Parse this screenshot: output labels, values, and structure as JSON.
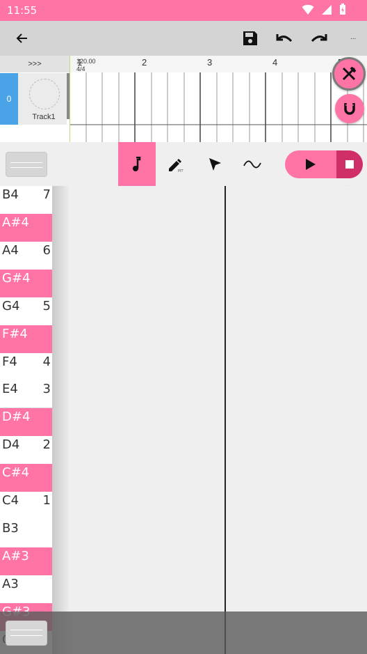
{
  "status": {
    "time": "11:55"
  },
  "toolbar": {
    "more_label": "..."
  },
  "tracks": {
    "header": ">>>",
    "ruler": {
      "bars": [
        "1",
        "2",
        "3",
        "4",
        "5"
      ],
      "tempo": "120.00",
      "time_signature": "4/4"
    },
    "items": [
      {
        "number": "0",
        "name": "Track1",
        "color": "#4aa3e6"
      }
    ]
  },
  "tools": [
    "note-tool",
    "pencil-tool",
    "select-tool",
    "curve-tool"
  ],
  "active_tool": "note-tool",
  "colors": {
    "accent": "#ff73a6",
    "accent_dark": "#cf2e68",
    "toolbar": "#d4d4d4"
  },
  "keys": [
    {
      "name": "B4",
      "octave": "7",
      "sharp": false
    },
    {
      "name": "A#4",
      "octave": "",
      "sharp": true
    },
    {
      "name": "A4",
      "octave": "6",
      "sharp": false
    },
    {
      "name": "G#4",
      "octave": "",
      "sharp": true
    },
    {
      "name": "G4",
      "octave": "5",
      "sharp": false
    },
    {
      "name": "F#4",
      "octave": "",
      "sharp": true
    },
    {
      "name": "F4",
      "octave": "4",
      "sharp": false
    },
    {
      "name": "E4",
      "octave": "3",
      "sharp": false
    },
    {
      "name": "D#4",
      "octave": "",
      "sharp": true
    },
    {
      "name": "D4",
      "octave": "2",
      "sharp": false
    },
    {
      "name": "C#4",
      "octave": "",
      "sharp": true
    },
    {
      "name": "C4",
      "octave": "1",
      "sharp": false
    },
    {
      "name": "B3",
      "octave": "",
      "sharp": false
    },
    {
      "name": "A#3",
      "octave": "",
      "sharp": true
    },
    {
      "name": "A3",
      "octave": "",
      "sharp": false
    },
    {
      "name": "G#3",
      "octave": "",
      "sharp": true
    },
    {
      "name": "G3",
      "octave": "",
      "sharp": false
    }
  ]
}
